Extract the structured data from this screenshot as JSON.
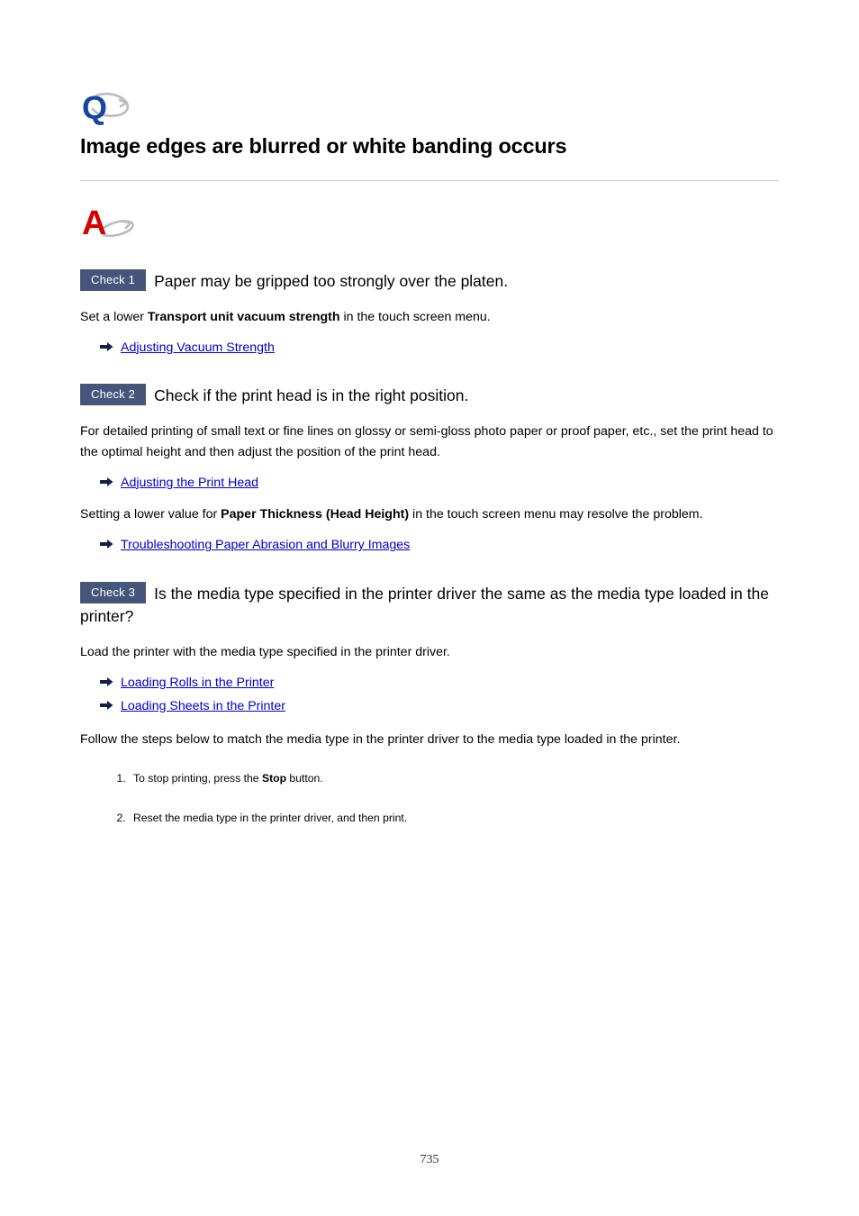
{
  "document": {
    "question_icon": "q-icon",
    "answer_icon": "a-icon",
    "title": "Image edges are blurred or white banding occurs",
    "page_number": "735"
  },
  "colors": {
    "badge_bg": "#46567a",
    "link": "#0000cc",
    "q_icon": "#16469d",
    "a_icon": "#d50000",
    "swoosh": "#b3b3b3",
    "rule": "#cfcfcf"
  },
  "checks": [
    {
      "badge": "Check 1",
      "title": "Paper may be gripped too strongly over the platen.",
      "paragraphs": [
        {
          "before": "Set a lower ",
          "bold": "Transport unit vacuum strength",
          "after": " in the touch screen menu."
        }
      ],
      "links": [
        {
          "icon": "arrow-right-icon",
          "label": "Adjusting Vacuum Strength"
        }
      ]
    },
    {
      "badge": "Check 2",
      "title": "Check if the print head is in the right position.",
      "paragraphs": [
        {
          "before": "For detailed printing of small text or fine lines on glossy or semi-gloss photo paper or proof paper, etc., set the print head to the optimal height and then adjust the position of the print head.",
          "bold": "",
          "after": ""
        }
      ],
      "links": [
        {
          "icon": "arrow-right-icon",
          "label": "Adjusting the Print Head"
        }
      ],
      "paragraphs2": [
        {
          "before": "Setting a lower value for ",
          "bold": "Paper Thickness (Head Height)",
          "after": " in the touch screen menu may resolve the problem."
        }
      ],
      "links2": [
        {
          "icon": "arrow-right-icon",
          "label": "Troubleshooting Paper Abrasion and Blurry Images"
        }
      ]
    },
    {
      "badge": "Check 3",
      "title": "Is the media type specified in the printer driver the same as the media type loaded in the printer?",
      "paragraphs": [
        {
          "before": "Load the printer with the media type specified in the printer driver.",
          "bold": "",
          "after": ""
        }
      ],
      "links": [
        {
          "icon": "arrow-right-icon",
          "label": "Loading Rolls in the Printer"
        },
        {
          "icon": "arrow-right-icon",
          "label": "Loading Sheets in the Printer"
        }
      ],
      "closing": "Follow the steps below to match the media type in the printer driver to the media type loaded in the printer.",
      "steps": [
        {
          "before": "To stop printing, press the ",
          "bold": "Stop",
          "after": " button."
        },
        {
          "before": "Reset the media type in the printer driver, and then print.",
          "bold": "",
          "after": ""
        }
      ]
    }
  ]
}
